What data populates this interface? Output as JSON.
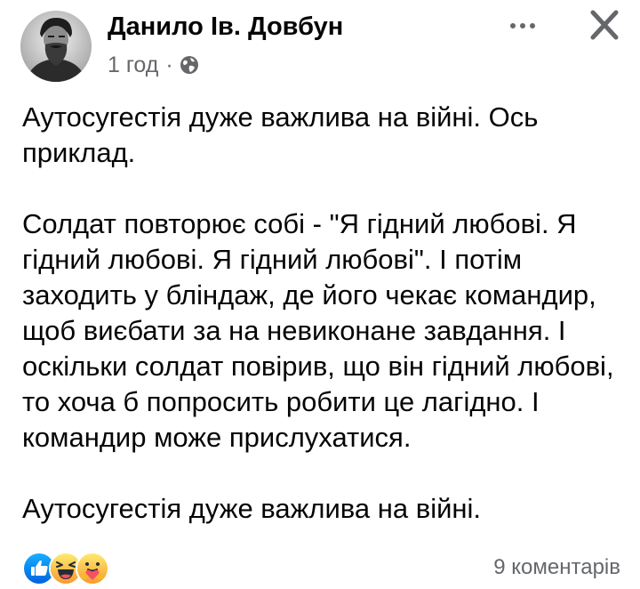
{
  "post": {
    "author": "Данило Ів. Довбун",
    "time": "1 год",
    "separator": "·",
    "paragraphs": [
      "Аутосугестія дуже важлива на війні. Ось приклад.",
      "Солдат повторює собі - \"Я гідний любові. Я гідний любові. Я гідний любові\". І потім заходить у бліндаж, де його чекає командир, щоб виєбати за на невиконане завдання. І оскільки солдат повірив, що він гідний любові, то хоча б попросить робити це лагідно. І командир може прислухатися.",
      "Аутосугестія дуже важлива на війні."
    ]
  },
  "footer": {
    "reactions": [
      "like-icon",
      "haha-icon",
      "care-icon"
    ],
    "comments_label": "9 коментарів"
  },
  "icons": {
    "more": "more-horizontal-icon",
    "close": "close-icon",
    "privacy": "globe-icon"
  },
  "colors": {
    "text": "#050505",
    "secondary_text": "#65676b",
    "like_blue": "#1877f2",
    "haha_yellow": "#f7b928"
  }
}
